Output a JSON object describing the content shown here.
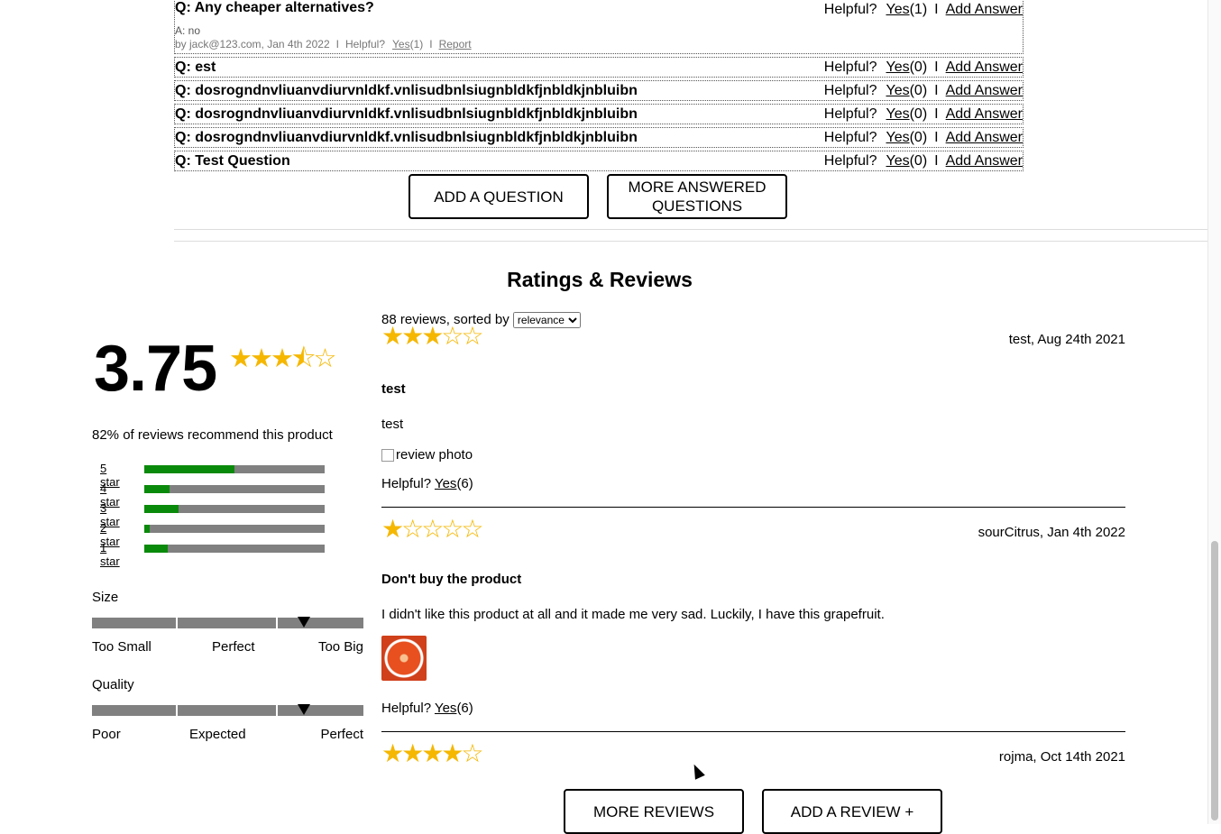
{
  "qa": {
    "expanded": {
      "question": "Q: Any cheaper alternatives?",
      "helpful_label": "Helpful?",
      "yes_label": "Yes",
      "yes_count": "(1)",
      "separator": "I",
      "add_answer_label": "Add Answer",
      "answer": "A: no",
      "answer_meta": "by jack@123.com, Jan 4th 2022",
      "answer_helpful_label": "Helpful?",
      "answer_yes_label": "Yes",
      "answer_yes_count": "(1)",
      "answer_report_label": "Report"
    },
    "questions": [
      {
        "question": "Q: est",
        "helpful_label": "Helpful?",
        "yes_label": "Yes",
        "yes_count": "(0)",
        "separator": "I",
        "add_answer_label": "Add Answer"
      },
      {
        "question": "Q: dosrogndnvliuanvdiurvnldkf.vnlisudbnlsiugnbldkfjnbldkjnbluibn",
        "helpful_label": "Helpful?",
        "yes_label": "Yes",
        "yes_count": "(0)",
        "separator": "I",
        "add_answer_label": "Add Answer"
      },
      {
        "question": "Q: dosrogndnvliuanvdiurvnldkf.vnlisudbnlsiugnbldkfjnbldkjnbluibn",
        "helpful_label": "Helpful?",
        "yes_label": "Yes",
        "yes_count": "(0)",
        "separator": "I",
        "add_answer_label": "Add Answer"
      },
      {
        "question": "Q: dosrogndnvliuanvdiurvnldkf.vnlisudbnlsiugnbldkfjnbldkjnbluibn",
        "helpful_label": "Helpful?",
        "yes_label": "Yes",
        "yes_count": "(0)",
        "separator": "I",
        "add_answer_label": "Add Answer"
      },
      {
        "question": "Q: Test Question",
        "helpful_label": "Helpful?",
        "yes_label": "Yes",
        "yes_count": "(0)",
        "separator": "I",
        "add_answer_label": "Add Answer"
      }
    ],
    "add_question_label": "ADD A QUESTION",
    "more_answered_label": "MORE ANSWERED QUESTIONS"
  },
  "ratings": {
    "title": "Ratings & Reviews",
    "average": "3.75",
    "average_stars": "★★★⯪☆",
    "recommend_text": "82% of reviews recommend this product",
    "breakdown": [
      {
        "label": "5 star",
        "fraction": 0.5
      },
      {
        "label": "4 star",
        "fraction": 0.14
      },
      {
        "label": "3 star",
        "fraction": 0.19
      },
      {
        "label": "2 star",
        "fraction": 0.03
      },
      {
        "label": "1 star",
        "fraction": 0.13
      }
    ],
    "characteristics": [
      {
        "name": "Size",
        "value": 0.78,
        "labels": [
          "Too Small",
          "Perfect",
          "Too Big"
        ]
      },
      {
        "name": "Quality",
        "value": 0.78,
        "labels": [
          "Poor",
          "Expected",
          "Perfect"
        ]
      }
    ]
  },
  "reviews": {
    "count_text": "88 reviews, sorted by",
    "sort_selected": "relevance",
    "items": [
      {
        "stars": "★★★☆☆",
        "meta": "test, Aug 24th 2021",
        "summary": "test",
        "body": "test",
        "photo_alt": "review photo",
        "helpful_label": "Helpful?",
        "yes_label": "Yes",
        "yes_count": "(6)"
      },
      {
        "stars": "★☆☆☆☆",
        "meta": "sourCitrus, Jan 4th 2022",
        "summary": "Don't buy the product",
        "body": "I didn't like this product at all and it made me very sad. Luckily, I have this grapefruit.",
        "helpful_label": "Helpful?",
        "yes_label": "Yes",
        "yes_count": "(6)"
      },
      {
        "stars": "★★★★☆",
        "meta": "rojma, Oct 14th 2021"
      }
    ],
    "more_reviews_label": "MORE REVIEWS",
    "add_review_label": "ADD A REVIEW +"
  },
  "colors": {
    "star": "#f5b700",
    "bar_fill": "#0a8a0a",
    "bar_track": "#808080"
  }
}
